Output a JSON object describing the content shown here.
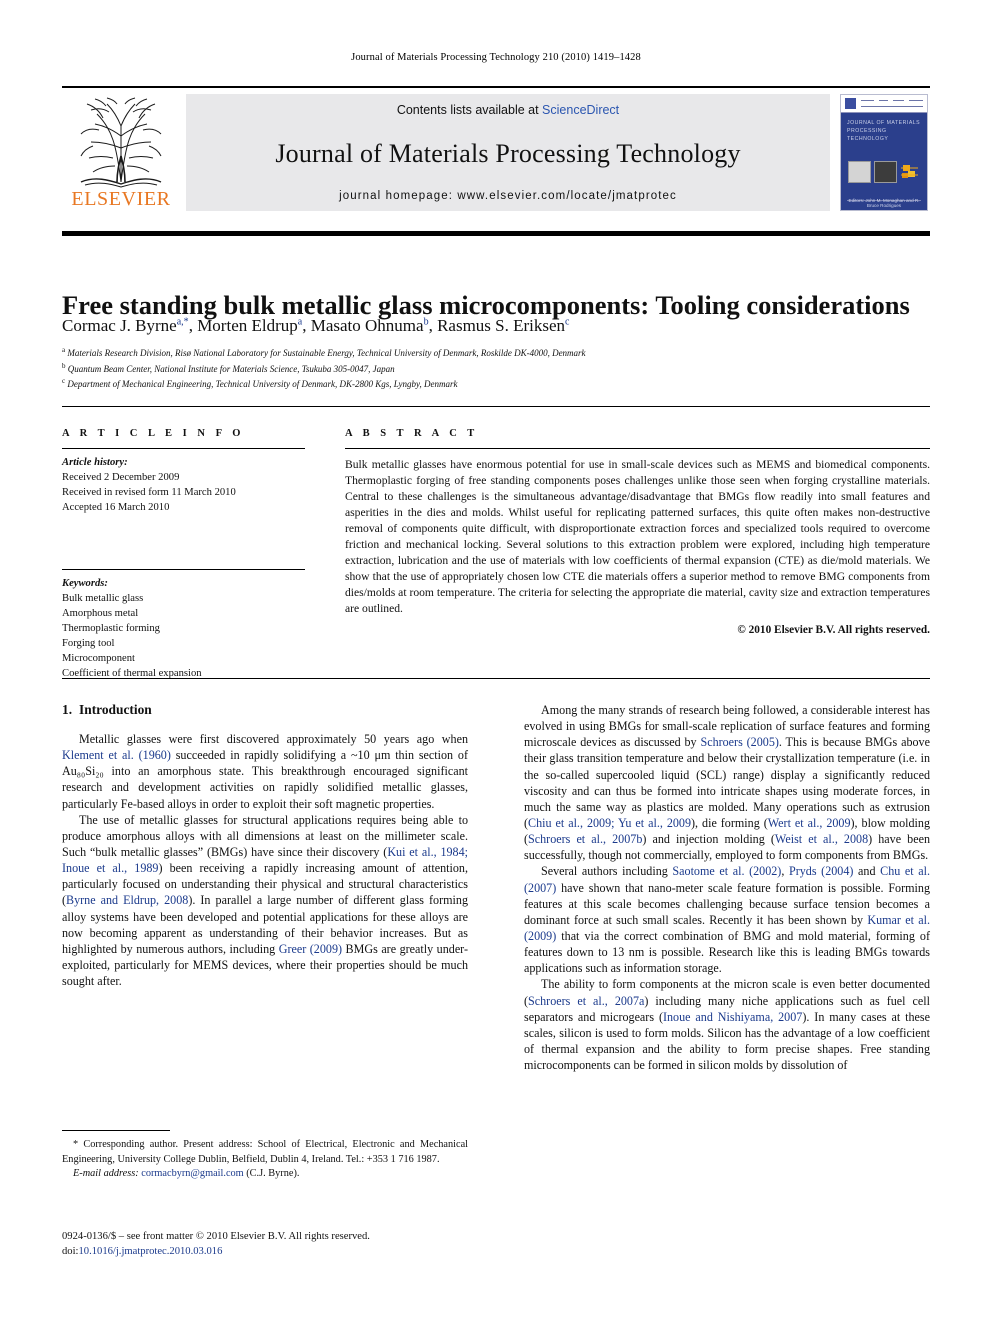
{
  "running_head": "Journal of Materials Processing Technology 210 (2010) 1419–1428",
  "masthead": {
    "publisher": "ELSEVIER",
    "contents_prefix": "Contents lists available at ",
    "contents_link": "ScienceDirect",
    "journal_name": "Journal of Materials Processing Technology",
    "homepage_prefix": "journal homepage: ",
    "homepage_url": "www.elsevier.com/locate/jmatprotec",
    "cover": {
      "title_line1": "JOURNAL OF MATERIALS",
      "title_line2": "PROCESSING TECHNOLOGY",
      "footer": "Editors: John M. Monaghan and R. Bruce Rodrigues"
    }
  },
  "article": {
    "title": "Free standing bulk metallic glass microcomponents: Tooling considerations",
    "authors": [
      {
        "name": "Cormac J. Byrne",
        "marks": "a,*"
      },
      {
        "name": "Morten Eldrup",
        "marks": "a"
      },
      {
        "name": "Masato Ohnuma",
        "marks": "b"
      },
      {
        "name": "Rasmus S. Eriksen",
        "marks": "c"
      }
    ],
    "affiliations": [
      {
        "mark": "a",
        "text": "Materials Research Division, Risø National Laboratory for Sustainable Energy, Technical University of Denmark, Roskilde DK-4000, Denmark"
      },
      {
        "mark": "b",
        "text": "Quantum Beam Center, National Institute for Materials Science, Tsukuba 305-0047, Japan"
      },
      {
        "mark": "c",
        "text": "Department of Mechanical Engineering, Technical University of Denmark, DK-2800 Kgs, Lyngby, Denmark"
      }
    ]
  },
  "article_info": {
    "heading": "A R T I C L E    I N F O",
    "history_label": "Article history:",
    "history": [
      "Received 2 December 2009",
      "Received in revised form 11 March 2010",
      "Accepted 16 March 2010"
    ],
    "keywords_label": "Keywords:",
    "keywords": [
      "Bulk metallic glass",
      "Amorphous metal",
      "Thermoplastic forming",
      "Forging tool",
      "Microcomponent",
      "Coefficient of thermal expansion"
    ]
  },
  "abstract": {
    "heading": "A B S T R A C T",
    "text": "Bulk metallic glasses have enormous potential for use in small-scale devices such as MEMS and biomedical components. Thermoplastic forging of free standing components poses challenges unlike those seen when forging crystalline materials. Central to these challenges is the simultaneous advantage/disadvantage that BMGs flow readily into small features and asperities in the dies and molds. Whilst useful for replicating patterned surfaces, this quite often makes non-destructive removal of components quite difficult, with disproportionate extraction forces and specialized tools required to overcome friction and mechanical locking. Several solutions to this extraction problem were explored, including high temperature extraction, lubrication and the use of materials with low coefficients of thermal expansion (CTE) as die/mold materials. We show that the use of appropriately chosen low CTE die materials offers a superior method to remove BMG components from dies/molds at room temperature. The criteria for selecting the appropriate die material, cavity size and extraction temperatures are outlined.",
    "copyright": "© 2010 Elsevier B.V. All rights reserved."
  },
  "body": {
    "section1": {
      "number": "1.",
      "title": "Introduction"
    },
    "left_paragraphs": [
      {
        "parts": [
          {
            "t": "Metallic glasses were first discovered approximately 50 years ago when ",
            "k": "plain"
          },
          {
            "t": "Klement et al. (1960)",
            "k": "ref"
          },
          {
            "t": " succeeded in rapidly solidifying a ~10 μm thin section of Au₈₀Si₂₀ into an amorphous state. This breakthrough encouraged significant research and development activities on rapidly solidified metallic glasses, particularly Fe-based alloys in order to exploit their soft magnetic properties.",
            "k": "plain"
          }
        ]
      },
      {
        "parts": [
          {
            "t": "The use of metallic glasses for structural applications requires being able to produce amorphous alloys with all dimensions at least on the millimeter scale. Such “bulk metallic glasses” (BMGs) have since their discovery (",
            "k": "plain"
          },
          {
            "t": "Kui et al., 1984; Inoue et al., 1989",
            "k": "ref"
          },
          {
            "t": ") been receiving a rapidly increasing amount of attention, particularly focused on understanding their physical and structural characteristics (",
            "k": "plain"
          },
          {
            "t": "Byrne and Eldrup, 2008",
            "k": "ref"
          },
          {
            "t": "). In parallel a large number of different glass forming alloy systems have been developed and potential applications for these alloys are now becoming apparent as understanding of their behavior increases. But as highlighted by numerous authors, including ",
            "k": "plain"
          },
          {
            "t": "Greer (2009)",
            "k": "ref"
          },
          {
            "t": " BMGs are greatly under-exploited, particularly for MEMS devices, where their properties should be much sought after.",
            "k": "plain"
          }
        ]
      }
    ],
    "right_paragraphs": [
      {
        "parts": [
          {
            "t": "Among the many strands of research being followed, a considerable interest has evolved in using BMGs for small-scale replication of surface features and forming microscale devices as discussed by ",
            "k": "plain"
          },
          {
            "t": "Schroers (2005)",
            "k": "ref"
          },
          {
            "t": ". This is because BMGs above their glass transition temperature and below their crystallization temperature (i.e. in the so-called supercooled liquid (SCL) range) display a significantly reduced viscosity and can thus be formed into intricate shapes using moderate forces, in much the same way as plastics are molded. Many operations such as extrusion (",
            "k": "plain"
          },
          {
            "t": "Chiu et al., 2009; Yu et al., 2009",
            "k": "ref"
          },
          {
            "t": "), die forming (",
            "k": "plain"
          },
          {
            "t": "Wert et al., 2009",
            "k": "ref"
          },
          {
            "t": "), blow molding (",
            "k": "plain"
          },
          {
            "t": "Schroers et al., 2007b",
            "k": "ref"
          },
          {
            "t": ") and injection molding (",
            "k": "plain"
          },
          {
            "t": "Weist et al., 2008",
            "k": "ref"
          },
          {
            "t": ") have been successfully, though not commercially, employed to form components from BMGs.",
            "k": "plain"
          }
        ]
      },
      {
        "parts": [
          {
            "t": "Several authors including ",
            "k": "plain"
          },
          {
            "t": "Saotome et al. (2002)",
            "k": "ref"
          },
          {
            "t": ", ",
            "k": "plain"
          },
          {
            "t": "Pryds (2004)",
            "k": "ref"
          },
          {
            "t": " and ",
            "k": "plain"
          },
          {
            "t": "Chu et al. (2007)",
            "k": "ref"
          },
          {
            "t": " have shown that nano-meter scale feature formation is possible. Forming features at this scale becomes challenging because surface tension becomes a dominant force at such small scales. Recently it has been shown by ",
            "k": "plain"
          },
          {
            "t": "Kumar et al. (2009)",
            "k": "ref"
          },
          {
            "t": " that via the correct combination of BMG and mold material, forming of features down to 13 nm is possible. Research like this is leading BMGs towards applications such as information storage.",
            "k": "plain"
          }
        ]
      },
      {
        "parts": [
          {
            "t": "The ability to form components at the micron scale is even better documented (",
            "k": "plain"
          },
          {
            "t": "Schroers et al., 2007a",
            "k": "ref"
          },
          {
            "t": ") including many niche applications such as fuel cell separators and microgears (",
            "k": "plain"
          },
          {
            "t": "Inoue and Nishiyama, 2007",
            "k": "ref"
          },
          {
            "t": "). In many cases at these scales, silicon is used to form molds. Silicon has the advantage of a low coefficient of thermal expansion and the ability to form precise shapes. Free standing microcomponents can be formed in silicon molds by dissolution of",
            "k": "plain"
          }
        ]
      }
    ]
  },
  "footnote": {
    "corresponding": "* Corresponding author. Present address: School of Electrical, Electronic and Mechanical Engineering, University College Dublin, Belfield, Dublin 4, Ireland. Tel.: +353 1 716 1987.",
    "email_label": "E-mail address:",
    "email": "cormacbyrn@gmail.com",
    "email_owner": "(C.J. Byrne)."
  },
  "imprint": {
    "line1": "0924-0136/$ – see front matter © 2010 Elsevier B.V. All rights reserved.",
    "doi_label": "doi:",
    "doi": "10.1016/j.jmatprotec.2010.03.016"
  },
  "colors": {
    "link": "#1b3a8c",
    "sciencedirect": "#2b56b0",
    "elsevier_orange": "#E87722",
    "banner_bg": "#e8e8ea",
    "cover_blue": "#2b3f8c"
  }
}
